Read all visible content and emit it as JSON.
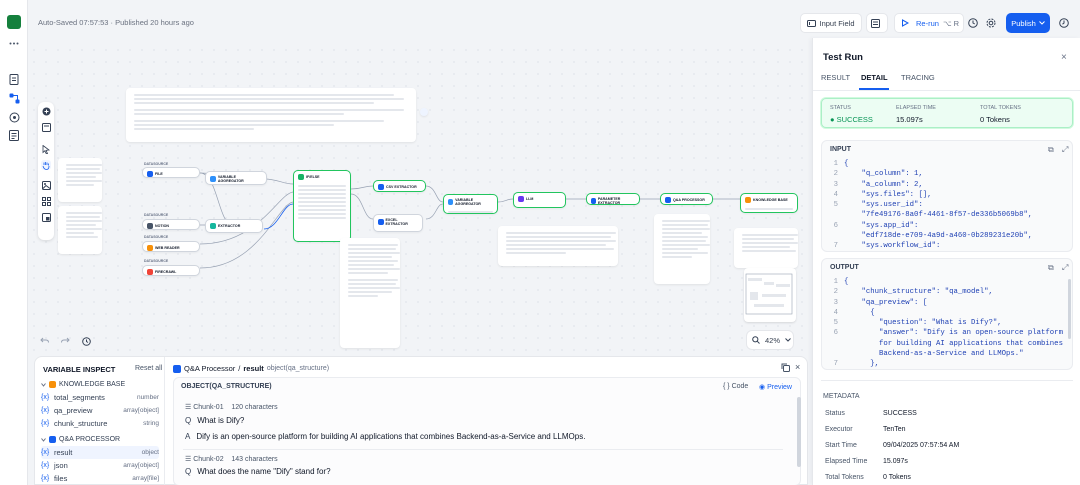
{
  "header": {
    "autosave": "Auto-Saved 07:57:53 · Published 20 hours ago",
    "input_field": "Input Field",
    "rerun": "Re-run",
    "rerun_shortcut": "⌥ R",
    "publish": "Publish"
  },
  "canvas": {
    "zoom": "42%"
  },
  "variable_inspect": {
    "title": "VARIABLE INSPECT",
    "reset_all": "Reset all",
    "groups": [
      {
        "name": "KNOWLEDGE BASE",
        "items": [
          {
            "name": "total_segments",
            "type": "number"
          },
          {
            "name": "qa_preview",
            "type": "array[object]"
          },
          {
            "name": "chunk_structure",
            "type": "string"
          }
        ]
      },
      {
        "name": "Q&A PROCESSOR",
        "items": [
          {
            "name": "result",
            "type": "object"
          },
          {
            "name": "json",
            "type": "array[object]"
          },
          {
            "name": "files",
            "type": "array[file]"
          }
        ]
      }
    ],
    "selected": {
      "node": "Q&A Processor",
      "var": "result",
      "type": "object(qa_structure)",
      "type_header": "OBJECT(QA_STRUCTURE)"
    },
    "code_label": "Code",
    "preview_label": "Preview",
    "chunks": [
      {
        "id": "Chunk-01",
        "chars": "120 characters",
        "q": "What is Dify?",
        "a": "Dify is an open-source platform for building AI applications that combines Backend-as-a-Service and LLMOps."
      },
      {
        "id": "Chunk-02",
        "chars": "143 characters",
        "q": "What does the name \"Dify\" stand for?"
      }
    ]
  },
  "panel": {
    "title": "Test Run",
    "tabs": [
      "RESULT",
      "DETAIL",
      "TRACING"
    ],
    "active_tab": "DETAIL",
    "status": {
      "status_label": "STATUS",
      "status_value": "SUCCESS",
      "elapsed_label": "ELAPSED TIME",
      "elapsed_value": "15.097s",
      "tokens_label": "TOTAL TOKENS",
      "tokens_value": "0 Tokens"
    },
    "input": {
      "label": "INPUT",
      "lines": [
        {
          "n": "1",
          "t": "{"
        },
        {
          "n": "2",
          "t": "    \"q_column\": 1,"
        },
        {
          "n": "3",
          "t": "    \"a_column\": 2,"
        },
        {
          "n": "4",
          "t": "    \"sys.files\": [],"
        },
        {
          "n": "5",
          "t": "    \"sys.user_id\":"
        },
        {
          "n": "",
          "t": "    \"7fe49176-8a0f-4461-8f57-de336b5069b8\","
        },
        {
          "n": "6",
          "t": "    \"sys.app_id\":"
        },
        {
          "n": "",
          "t": "    \"edf718de-e709-4a9d-a460-0b289231e20b\","
        },
        {
          "n": "7",
          "t": "    \"sys.workflow_id\":"
        }
      ]
    },
    "output": {
      "label": "OUTPUT",
      "lines": [
        {
          "n": "1",
          "t": "{"
        },
        {
          "n": "2",
          "t": "    \"chunk_structure\": \"qa_model\","
        },
        {
          "n": "3",
          "t": "    \"qa_preview\": ["
        },
        {
          "n": "4",
          "t": "      {"
        },
        {
          "n": "5",
          "t": "        \"question\": \"What is Dify?\","
        },
        {
          "n": "6",
          "t": "        \"answer\": \"Dify is an open-source platform"
        },
        {
          "n": "",
          "t": "        for building AI applications that combines"
        },
        {
          "n": "",
          "t": "        Backend-as-a-Service and LLMOps.\""
        },
        {
          "n": "7",
          "t": "      },"
        }
      ]
    },
    "metadata": {
      "title": "METADATA",
      "rows": [
        {
          "label": "Status",
          "value": "SUCCESS"
        },
        {
          "label": "Executor",
          "value": "TenTen"
        },
        {
          "label": "Start Time",
          "value": "09/04/2025 07:57:54 AM"
        },
        {
          "label": "Elapsed Time",
          "value": "15.097s"
        },
        {
          "label": "Total Tokens",
          "value": "0 Tokens"
        }
      ]
    }
  }
}
